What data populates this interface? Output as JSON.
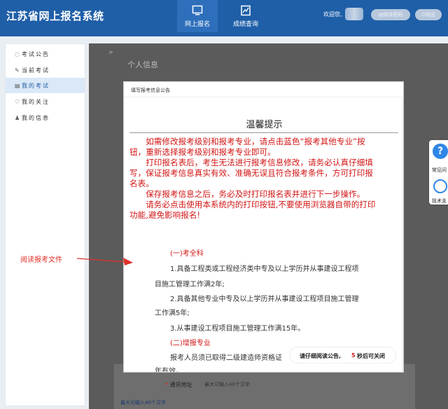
{
  "header": {
    "app_title": "江苏省网上报名系统",
    "nav": [
      {
        "label": "网上报名",
        "icon": "monitor-icon",
        "active": true
      },
      {
        "label": "成绩查询",
        "icon": "chart-doc-icon",
        "active": false
      }
    ],
    "welcome": "欢迎您,",
    "change_password": "修改密码",
    "logout": "退出"
  },
  "sidebar": {
    "items": [
      {
        "label": "考试公告",
        "icon": "speaker-icon"
      },
      {
        "label": "当前考试",
        "icon": "edit-icon"
      },
      {
        "label": "我的考试",
        "icon": "list-icon",
        "active": true
      },
      {
        "label": "我的关注",
        "icon": "heart-icon"
      },
      {
        "label": "我的信息",
        "icon": "user-icon"
      }
    ]
  },
  "main": {
    "breadcrumb": ">",
    "section_title": "个人信息",
    "address_label": "通讯地址",
    "address_placeholder": "最大可输入40个汉字",
    "max_note": "最大可输入40个汉字"
  },
  "modal": {
    "header_title": "填写报考信息公告",
    "notice_title": "温馨提示",
    "red_paragraphs": [
      "如需修改报考级别和报考专业，请点击蓝色“报考其他专业”按钮，重新选择报考级别和报考专业即可。",
      "打印报名表后，考生无法进行报考信息修改，请务必认真仔细填写，保证报考信息真实有效、准确无误且符合报考条件，方可打印报名表。",
      "保存报考信息之后，务必及时打印报名表并进行下一步操作。",
      "请务必点击使用本系统内的打印按钮,不要使用浏览器自带的打印功能,避免影响报名!"
    ],
    "section1": "(一)考全科",
    "req1_a": "1.具备工程类或工程经济类中专及以上学历并从事建设工程项",
    "req1_b": "目施工管理工作满2年;",
    "req2_a": "2.具备其他专业中专及以上学历并从事建设工程项目施工管理",
    "req2_b": "工作满5年;",
    "req3": "3.从事建设工程项目施工管理工作满15年。",
    "section2": "(二)增报专业",
    "extra_a": "报考人员须已取得二级建造师资格证",
    "extra_b": "年有效。"
  },
  "toast": {
    "prefix": "请仔细阅读公告,",
    "seconds": "5",
    "suffix": "秒后可关闭"
  },
  "annotation": {
    "text": "阅读报考文件"
  },
  "float_panel": {
    "faq": "常见问",
    "support": "技术支"
  }
}
